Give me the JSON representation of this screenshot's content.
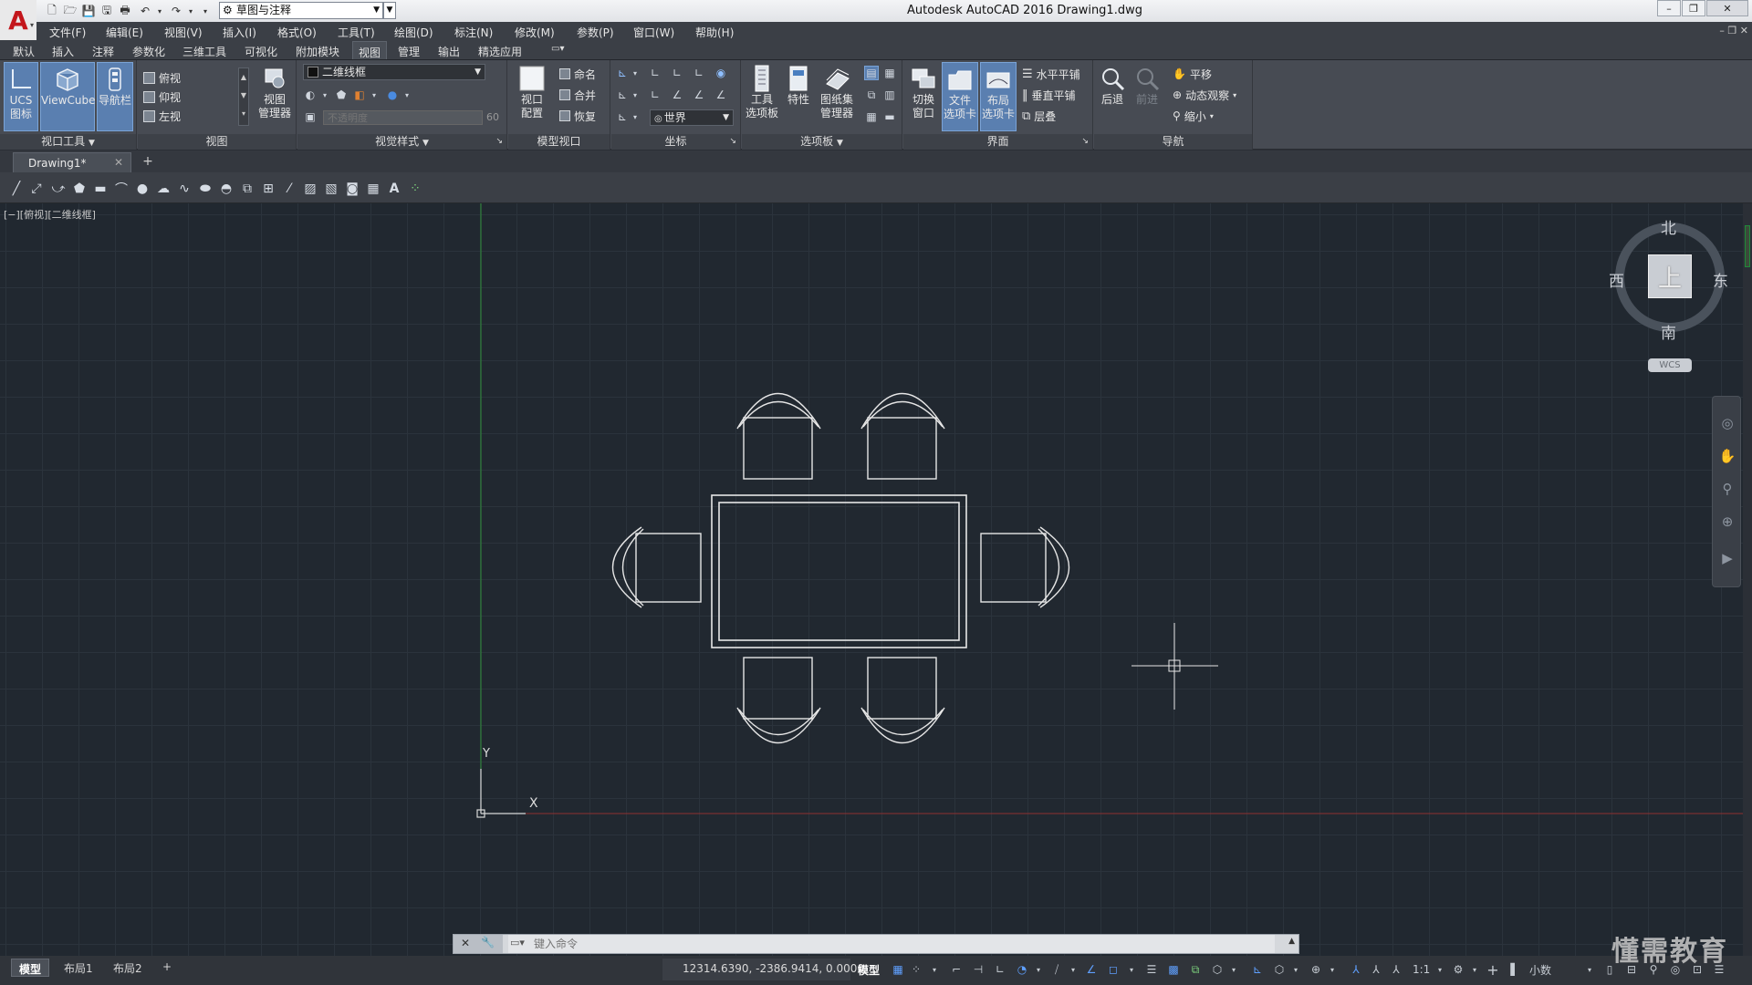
{
  "app": {
    "title": "Autodesk AutoCAD 2016    Drawing1.dwg",
    "workspace": "草图与注释",
    "logo_letter": "A"
  },
  "window_controls": {
    "minimize": "–",
    "restore": "❐",
    "close": "✕"
  },
  "menubar": {
    "items": [
      "文件(F)",
      "编辑(E)",
      "视图(V)",
      "插入(I)",
      "格式(O)",
      "工具(T)",
      "绘图(D)",
      "标注(N)",
      "修改(M)",
      "参数(P)",
      "窗口(W)",
      "帮助(H)"
    ],
    "doc_controls": "– ❐ ✕"
  },
  "ribbon_tabs": {
    "items": [
      "默认",
      "插入",
      "注释",
      "参数化",
      "三维工具",
      "可视化",
      "附加模块",
      "视图",
      "管理",
      "输出",
      "精选应用"
    ],
    "active": "视图"
  },
  "ribbon": {
    "viewport_tools": {
      "title": "视口工具",
      "buttons": [
        {
          "label": "UCS\n图标",
          "icon": "ucs-icon",
          "active": true
        },
        {
          "label": "ViewCube",
          "icon": "viewcube-icon",
          "active": true
        },
        {
          "label": "导航栏",
          "icon": "navbar-icon",
          "active": true
        }
      ]
    },
    "views": {
      "title": "视图",
      "items": [
        "俯视",
        "仰视",
        "左视"
      ],
      "manager": "视图\n管理器"
    },
    "visual_styles": {
      "title": "视觉样式",
      "current": "二维线框",
      "opacity_placeholder": "不透明度",
      "opacity_value": "60"
    },
    "model_viewports": {
      "title": "模型视口",
      "config": "视口\n配置",
      "items": [
        "命名",
        "合并",
        "恢复"
      ]
    },
    "coordinates": {
      "title": "坐标",
      "ucs_current": "世界"
    },
    "palettes": {
      "title": "选项板",
      "buttons": [
        "工具\n选项板",
        "特性",
        "图纸集\n管理器"
      ]
    },
    "interface": {
      "title": "界面",
      "buttons": [
        {
          "label": "切换\n窗口",
          "active": false
        },
        {
          "label": "文件\n选项卡",
          "active": true
        },
        {
          "label": "布局\n选项卡",
          "active": true
        }
      ],
      "items": [
        "水平平铺",
        "垂直平铺",
        "层叠"
      ]
    },
    "navigate": {
      "title": "导航",
      "back": "后退",
      "forward": "前进",
      "items": [
        "平移",
        "动态观察",
        "缩小"
      ]
    }
  },
  "file_tabs": {
    "current": "Drawing1*",
    "close": "✕",
    "add": "+"
  },
  "viewport": {
    "label": "[−][俯视][二维线框]",
    "compass": {
      "north": "北",
      "south": "南",
      "east": "东",
      "west": "西",
      "face": "上"
    },
    "wcs": "WCS",
    "ucs_x": "X",
    "ucs_y": "Y"
  },
  "command_line": {
    "placeholder": "键入命令"
  },
  "layout_tabs": {
    "items": [
      "模型",
      "布局1",
      "布局2"
    ],
    "active": "模型",
    "add": "+"
  },
  "status_bar": {
    "coordinates": "12314.6390, -2386.9414, 0.0000",
    "model": "模型",
    "scale": "1:1",
    "units": "小数"
  },
  "watermark": "懂需教育",
  "colors": {
    "canvas_bg": "#212830",
    "grid": "#2b333c",
    "accent_active": "#5a7fb0",
    "y_axis": "#2f8f3a",
    "x_axis": "#8f2f2f",
    "drawing_lines": "#e6e6e6"
  }
}
